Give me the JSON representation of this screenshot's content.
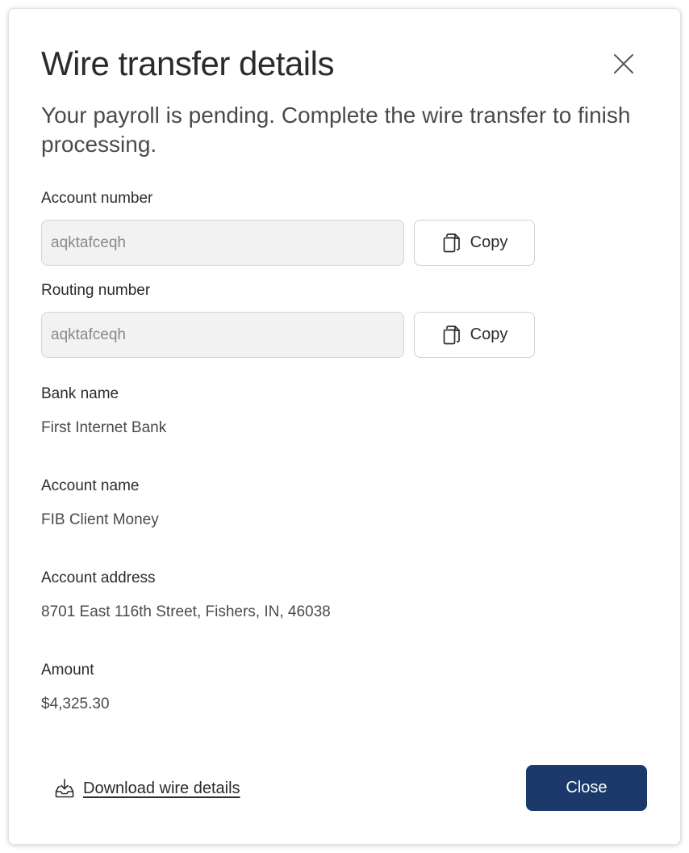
{
  "modal": {
    "title": "Wire transfer details",
    "subtitle": "Your payroll is pending. Complete the wire transfer to finish processing."
  },
  "fields": {
    "account_number": {
      "label": "Account number",
      "placeholder": "aqktafceqh",
      "copy_label": "Copy"
    },
    "routing_number": {
      "label": "Routing number",
      "placeholder": "aqktafceqh",
      "copy_label": "Copy"
    }
  },
  "details": {
    "bank_name": {
      "label": "Bank name",
      "value": "First Internet Bank"
    },
    "account_name": {
      "label": "Account name",
      "value": "FIB Client Money"
    },
    "account_address": {
      "label": "Account address",
      "value": "8701 East 116th Street, Fishers, IN, 46038"
    },
    "amount": {
      "label": "Amount",
      "value": "$4,325.30"
    }
  },
  "footer": {
    "download_label": "Download wire details",
    "close_label": "Close"
  },
  "icons": {
    "close": "close-icon",
    "copy": "copy-icon",
    "download": "download-icon"
  },
  "colors": {
    "primary": "#1b3a6b",
    "input_bg": "#f2f2f2",
    "text": "#2b2b2b",
    "muted_text": "#4a4a4a"
  }
}
